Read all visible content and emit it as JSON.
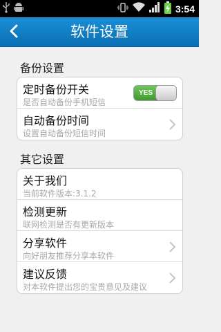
{
  "status_bar": {
    "time": "3:54",
    "icons": [
      "usb-icon",
      "android-debug-icon",
      "vibrate-icon",
      "wifi-icon",
      "signal-icon",
      "battery-charging-icon"
    ]
  },
  "header": {
    "title": "软件设置",
    "back_icon": "chevron-left-icon",
    "color": "#1b8fd6"
  },
  "backup_section": {
    "title": "备份设置",
    "items": [
      {
        "title": "定时备份开关",
        "subtitle": "是否自动备份手机短信",
        "toggle_label": "YES",
        "toggle_on": true
      },
      {
        "title": "自动备份时间",
        "subtitle": "设置自动备份短信时间"
      }
    ]
  },
  "other_section": {
    "title": "其它设置",
    "items": [
      {
        "title": "关于我们",
        "subtitle": "当前软件版本:3.1.2"
      },
      {
        "title": "检测更新",
        "subtitle": "联网检测是否有更新版本"
      },
      {
        "title": "分享软件",
        "subtitle": "向好朋友推荐分享本软件"
      },
      {
        "title": "建议反馈",
        "subtitle": "对本软件提出您的宝贵意见及建议"
      }
    ]
  }
}
